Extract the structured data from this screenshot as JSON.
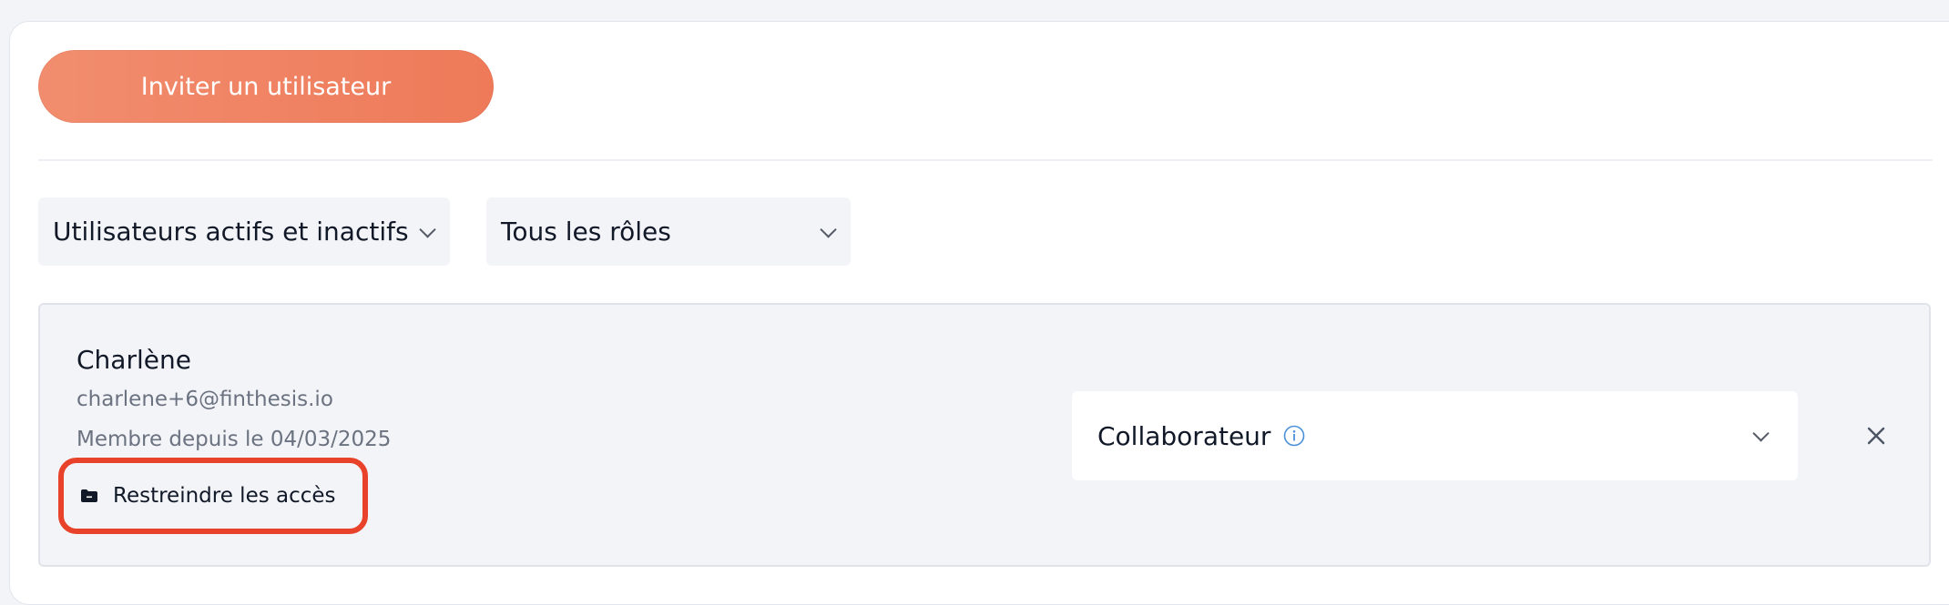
{
  "invite": {
    "label": "Inviter un utilisateur"
  },
  "filters": {
    "status": {
      "selected": "Utilisateurs actifs et inactifs"
    },
    "role": {
      "selected": "Tous les rôles"
    }
  },
  "users": [
    {
      "name": "Charlène",
      "email": "charlene+6@finthesis.io",
      "member_since": "Membre depuis le 04/03/2025",
      "restrict_label": "Restreindre les accès",
      "role": "Collaborateur"
    }
  ],
  "icons": {
    "status_chevron": "chevron-down-icon",
    "role_chevron": "chevron-down-icon",
    "restrict": "folder-icon",
    "role_info": "info-icon",
    "remove": "close-icon"
  },
  "colors": {
    "accent": "#ef7f5f",
    "highlight": "#e8432a",
    "info": "#4a90d9"
  }
}
